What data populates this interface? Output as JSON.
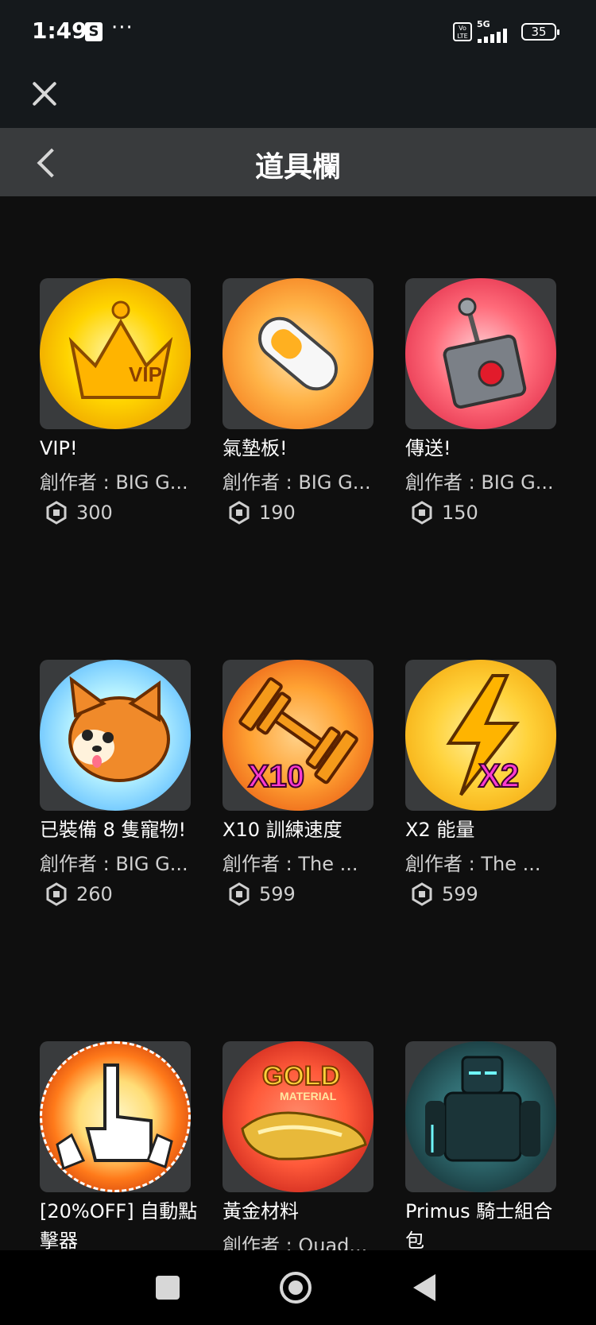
{
  "status_bar": {
    "time": "1:49",
    "app_icon": "shopping-bag-icon",
    "app_letter": "S",
    "more": "···",
    "volte": "Vo LTE",
    "network": "5G",
    "battery": "35"
  },
  "header": {
    "close_icon": "close-icon",
    "back_icon": "chevron-left-icon",
    "title": "道具欄"
  },
  "items": [
    {
      "name": "VIP!",
      "creator": "創作者 : BIG G...",
      "price": "300",
      "icon": "crown-vip-icon",
      "colors": [
        "#ffd400",
        "#e58a00"
      ]
    },
    {
      "name": "氣墊板!",
      "creator": "創作者 : BIG G...",
      "price": "190",
      "icon": "hoverboard-icon",
      "colors": [
        "#ffb347",
        "#f06a10"
      ]
    },
    {
      "name": "傳送!",
      "creator": "創作者 : BIG G...",
      "price": "150",
      "icon": "teleport-switch-icon",
      "colors": [
        "#ff6b7a",
        "#d81b3b"
      ]
    },
    {
      "name": "已裝備 8 隻寵物!",
      "creator": "創作者 : BIG G...",
      "price": "260",
      "icon": "pet-dog-icon",
      "colors": [
        "#b9f3ff",
        "#3aa7ff"
      ]
    },
    {
      "name": "X10 訓練速度",
      "creator": "創作者 : The ...",
      "price": "599",
      "icon": "dumbbell-x10-icon",
      "colors": [
        "#ffa233",
        "#e2440a"
      ]
    },
    {
      "name": "X2 能量",
      "creator": "創作者 : The ...",
      "price": "599",
      "icon": "lightning-x2-icon",
      "colors": [
        "#ffd23a",
        "#f09a00"
      ]
    },
    {
      "name": "[20%OFF] 自動點擊器",
      "creator": "",
      "price": "",
      "icon": "auto-clicker-hand-icon",
      "colors": [
        "#ffdd77",
        "#b01a00"
      ]
    },
    {
      "name": "黃金材料",
      "creator": "創作者 : Quad...",
      "price": "",
      "icon": "gold-material-icon",
      "colors": [
        "#ff5a3a",
        "#b40f0f"
      ]
    },
    {
      "name": "Primus 騎士組合包",
      "creator": "",
      "price": "",
      "icon": "knight-bundle-icon",
      "colors": [
        "#2f6a6f",
        "#0c1e22"
      ]
    }
  ],
  "badge_texts": {
    "vip": "VIP",
    "x10": "X10",
    "x2": "X2",
    "gold": "GOLD",
    "material": "MATERIAL"
  },
  "currency_icon": "robux-icon",
  "nav": {
    "recents_icon": "square-recents-icon",
    "home_icon": "circle-home-icon",
    "back_icon": "triangle-back-icon"
  }
}
